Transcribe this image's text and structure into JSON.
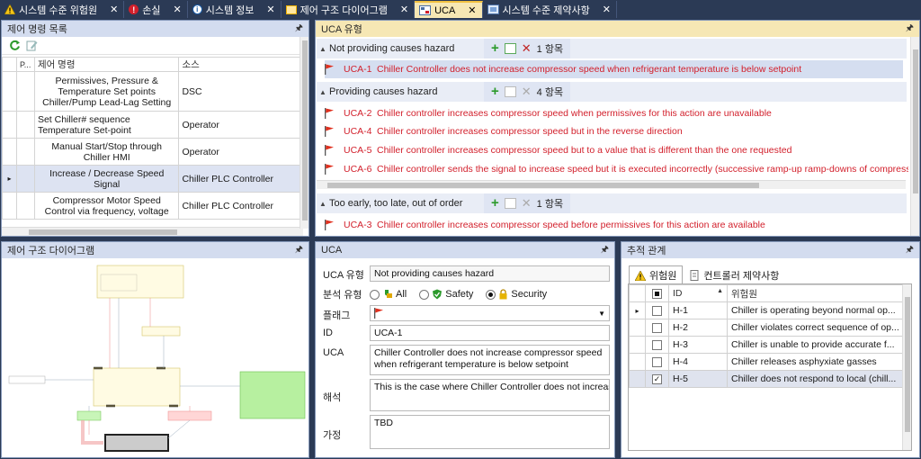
{
  "tabs": [
    {
      "label": "시스템 수준 위험원",
      "icon": "warning-icon",
      "close": "✕"
    },
    {
      "label": "손실",
      "icon": "error-icon",
      "close": "✕"
    },
    {
      "label": "시스템 정보",
      "icon": "info-icon",
      "close": "✕"
    },
    {
      "label": "제어 구조 다이어그램",
      "icon": "diagram-icon",
      "close": "✕"
    },
    {
      "label": "UCA",
      "icon": "uca-icon",
      "close": "✕",
      "active": true
    },
    {
      "label": "시스템 수준 제약사항",
      "icon": "constraint-icon",
      "close": "✕"
    }
  ],
  "command_panel": {
    "title": "제어 명령 목록",
    "pin": "🖈",
    "columns": [
      "P...",
      "제어 명령",
      "소스"
    ],
    "rows": [
      {
        "command": "Permissives, Pressure & Temperature Set points Chiller/Pump Lead-Lag Setting",
        "source": "DSC"
      },
      {
        "command": "Set Chiller# sequence Temperature Set-point",
        "source": "Operator"
      },
      {
        "command": "Manual Start/Stop through Chiller HMI",
        "source": "Operator"
      },
      {
        "command": "Increase / Decrease Speed Signal",
        "source": "Chiller PLC Controller",
        "selected": true,
        "marker": "▸"
      },
      {
        "command": "Compressor Motor Speed Control via frequency, voltage",
        "source": "Chiller PLC Controller"
      }
    ]
  },
  "uca_panel": {
    "title": "UCA 유형",
    "pin": "🖈",
    "groups": [
      {
        "label": "Not providing causes hazard",
        "count": "1 항목",
        "items": [
          {
            "id": "UCA-1",
            "text": "Chiller Controller does not increase compressor speed when refrigerant temperature is below setpoint",
            "selected": true
          }
        ]
      },
      {
        "label": "Providing causes hazard",
        "count": "4 항목",
        "items": [
          {
            "id": "UCA-2",
            "text": "Chiller controller increases compressor speed when permissives for this action are unavailable"
          },
          {
            "id": "UCA-4",
            "text": "Chiller controller increases compressor speed but in the reverse direction"
          },
          {
            "id": "UCA-5",
            "text": "Chiller controller increases compressor speed but to a value that is different than the one requested"
          },
          {
            "id": "UCA-6",
            "text": "Chiller controller sends the signal to increase speed but it is executed incorrectly (successive ramp-up ramp-downs of compressor sp"
          }
        ]
      },
      {
        "label": "Too early, too late, out of order",
        "count": "1 항목",
        "items": [
          {
            "id": "UCA-3",
            "text": "Chiller controller increases compressor speed before permissives for this action are available"
          }
        ]
      }
    ]
  },
  "diagram_panel": {
    "title": "제어 구조 다이어그램",
    "pin": "🖈"
  },
  "uca_detail": {
    "title": "UCA",
    "pin": "🖈",
    "type_label": "UCA 유형",
    "type_value": "Not providing causes hazard",
    "analysis_label": "분석 유형",
    "analysis_options": [
      "All",
      "Safety",
      "Security"
    ],
    "analysis_selected": "Security",
    "flag_label": "플래그",
    "id_label": "ID",
    "id_value": "UCA-1",
    "uca_label": "UCA",
    "uca_value": "Chiller Controller does not increase compressor speed when refrigerant temperature is below setpoint",
    "interpret_label": "해석",
    "interpret_value": "This is the case where Chiller Controller does not increase c",
    "assume_label": "가정",
    "assume_value": "TBD"
  },
  "trace_panel": {
    "title": "추적 관계",
    "pin": "🖈",
    "tabs": [
      "위험원",
      "컨트롤러 제약사항"
    ],
    "columns": [
      "ID",
      "위험원"
    ],
    "rows": [
      {
        "id": "H-1",
        "hazard": "Chiller is operating beyond normal op...",
        "checked": false,
        "marker": "▸"
      },
      {
        "id": "H-2",
        "hazard": "Chiller violates correct sequence of op...",
        "checked": false
      },
      {
        "id": "H-3",
        "hazard": "Chiller is unable to provide accurate f...",
        "checked": false
      },
      {
        "id": "H-4",
        "hazard": "Chiller releases asphyxiate gasses",
        "checked": false
      },
      {
        "id": "H-5",
        "hazard": "Chiller does not respond to local (chill...",
        "checked": true,
        "selected": true
      }
    ]
  },
  "colors": {
    "accent_tab": "#f6e7b4",
    "hazard_text": "#d21f2b",
    "frame": "#2b3a55"
  }
}
